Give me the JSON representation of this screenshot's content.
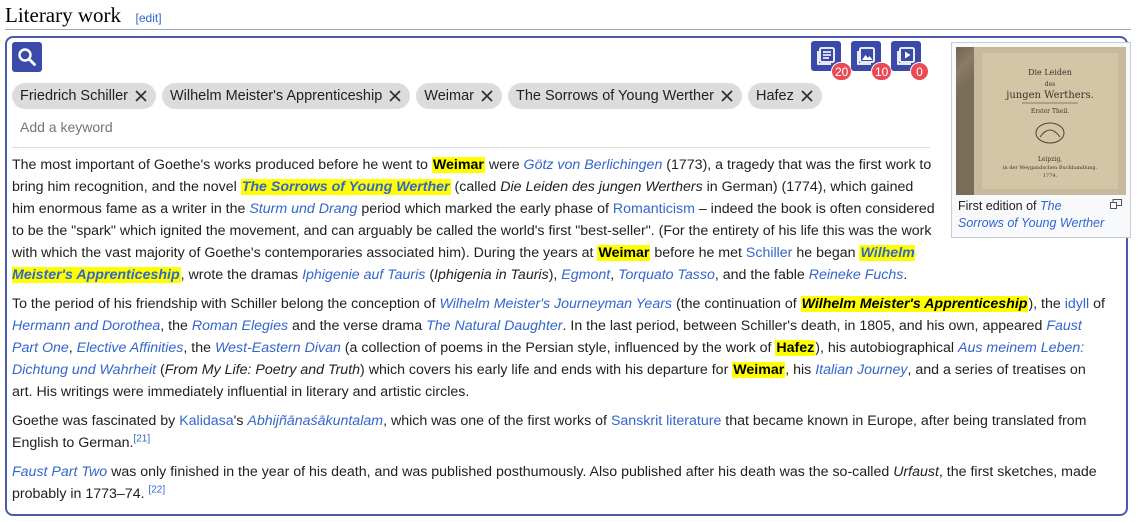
{
  "header": {
    "title": "Literary work",
    "edit_label": "edit"
  },
  "toolbar": {
    "tools": [
      {
        "name": "list-tool",
        "badge": "20"
      },
      {
        "name": "image-tool",
        "badge": "10"
      },
      {
        "name": "video-tool",
        "badge": "0"
      }
    ]
  },
  "chips": [
    "Friedrich Schiller",
    "Wilhelm Meister's Apprenticeship",
    "Weimar",
    "The Sorrows of Young Werther",
    "Hafez"
  ],
  "keyword_placeholder": "Add a keyword",
  "figure": {
    "caption_prefix": "First edition of ",
    "caption_link": "The Sorrows of Young Werther"
  },
  "article": {
    "p1": [
      {
        "t": "The most important of Goethe's works produced before he went to "
      },
      {
        "t": "Weimar",
        "hl": true
      },
      {
        "t": " were "
      },
      {
        "t": "Götz von Berlichingen",
        "link": true,
        "it": true
      },
      {
        "t": " (1773), a tragedy that was the first work to bring him recognition, and the novel "
      },
      {
        "t": "The Sorrows of Young Werther",
        "hl": true,
        "link": true,
        "it": true
      },
      {
        "t": " (called "
      },
      {
        "t": "Die Leiden des jungen Werthers",
        "it": true
      },
      {
        "t": " in German) (1774), which gained him enormous fame as a writer in the "
      },
      {
        "t": "Sturm und Drang",
        "link": true,
        "it": true
      },
      {
        "t": " period which marked the early phase of "
      },
      {
        "t": "Romanticism",
        "link": true
      },
      {
        "t": " – indeed the book is often considered to be the \"spark\" which ignited the movement, and can arguably be called the world's first \"best-seller\". (For the entirety of his life this was the work with which the vast majority of Goethe's contemporaries associated him). During the years at "
      },
      {
        "t": "Weimar",
        "hl": true
      },
      {
        "t": " before he met "
      },
      {
        "t": "Schiller",
        "link": true
      },
      {
        "t": " he began "
      },
      {
        "t": "Wilhelm Meister's Apprenticeship",
        "hl": true,
        "link": true,
        "it": true
      },
      {
        "t": ", wrote the dramas "
      },
      {
        "t": "Iphigenie auf Tauris",
        "link": true,
        "it": true
      },
      {
        "t": " ("
      },
      {
        "t": "Iphigenia in Tauris",
        "it": true
      },
      {
        "t": "), "
      },
      {
        "t": "Egmont",
        "link": true,
        "it": true
      },
      {
        "t": ", "
      },
      {
        "t": "Torquato Tasso",
        "link": true,
        "it": true
      },
      {
        "t": ", and the fable "
      },
      {
        "t": "Reineke Fuchs",
        "link": true,
        "it": true
      },
      {
        "t": "."
      }
    ],
    "p2": [
      {
        "t": "To the period of his friendship with Schiller belong the conception of "
      },
      {
        "t": "Wilhelm Meister's Journeyman Years",
        "link": true,
        "it": true
      },
      {
        "t": " (the continuation of "
      },
      {
        "t": "Wilhelm Meister's Apprenticeship",
        "hl": true,
        "it": true
      },
      {
        "t": "), the "
      },
      {
        "t": "idyll",
        "link": true
      },
      {
        "t": " of "
      },
      {
        "t": "Hermann and Dorothea",
        "link": true,
        "it": true
      },
      {
        "t": ", the "
      },
      {
        "t": "Roman Elegies",
        "link": true,
        "it": true
      },
      {
        "t": " and the verse drama "
      },
      {
        "t": "The Natural Daughter",
        "link": true,
        "it": true
      },
      {
        "t": ". In the last period, between Schiller's death, in 1805, and his own, appeared "
      },
      {
        "t": "Faust Part One",
        "link": true,
        "it": true
      },
      {
        "t": ", "
      },
      {
        "t": "Elective Affinities",
        "link": true,
        "it": true
      },
      {
        "t": ", the "
      },
      {
        "t": "West-Eastern Divan",
        "link": true,
        "it": true
      },
      {
        "t": " (a collection of poems in the Persian style, influenced by the work of "
      },
      {
        "t": "Hafez",
        "hl": true
      },
      {
        "t": "), his autobiographical "
      },
      {
        "t": "Aus meinem Leben: Dichtung und Wahrheit",
        "link": true,
        "it": true
      },
      {
        "t": " ("
      },
      {
        "t": "From My Life: Poetry and Truth",
        "it": true
      },
      {
        "t": ") which covers his early life and ends with his departure for "
      },
      {
        "t": "Weimar",
        "hl": true
      },
      {
        "t": ", his "
      },
      {
        "t": "Italian Journey",
        "link": true,
        "it": true
      },
      {
        "t": ", and a series of treatises on art. His writings were immediately influential in literary and artistic circles."
      }
    ],
    "p3": [
      {
        "t": "Goethe was fascinated by "
      },
      {
        "t": "Kalidasa",
        "link": true
      },
      {
        "t": "'s "
      },
      {
        "t": "Abhijñānaśākuntalam",
        "link": true,
        "it": true
      },
      {
        "t": ", which was one of the first works of "
      },
      {
        "t": "Sanskrit literature",
        "link": true
      },
      {
        "t": " that became known in Europe, after being translated from English to German."
      },
      {
        "t": "[21]",
        "sup": true,
        "link": true
      }
    ],
    "p4": [
      {
        "t": "Faust Part Two",
        "link": true,
        "it": true
      },
      {
        "t": " was only finished in the year of his death, and was published posthumously. Also published after his death was the so-called "
      },
      {
        "t": "Urfaust",
        "it": true
      },
      {
        "t": ", the first sketches, made probably in 1773–74. "
      },
      {
        "t": "[22]",
        "sup": true,
        "link": true
      }
    ]
  },
  "colors": {
    "accent": "#3a4aa8",
    "badge": "#e94b55",
    "highlight": "#ffff00",
    "link": "#3366cc"
  }
}
